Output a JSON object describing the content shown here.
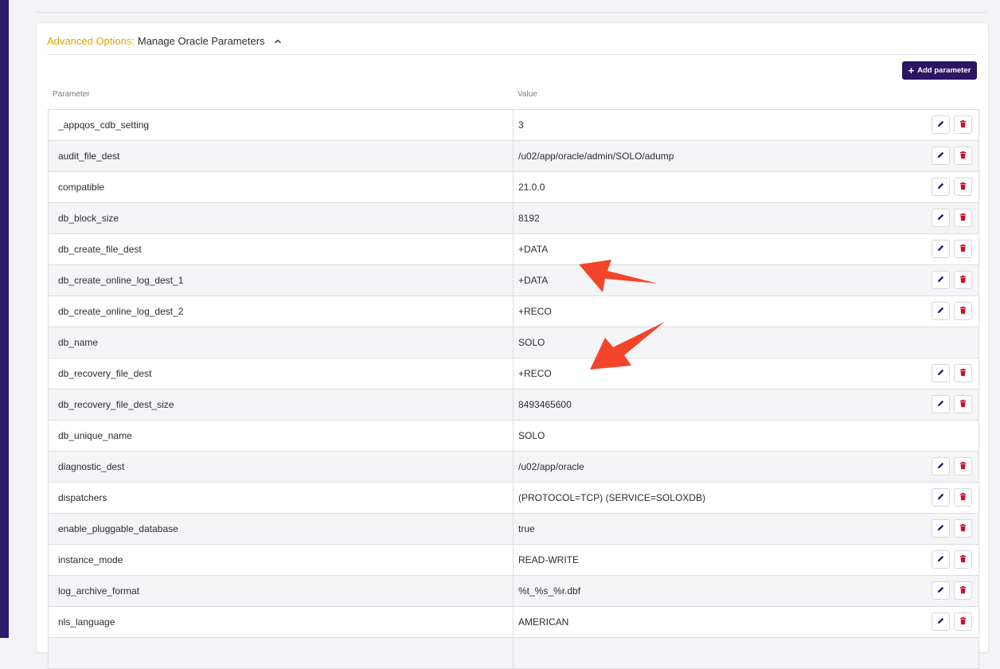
{
  "panel": {
    "title_accent": "Advanced Options:",
    "title_main": "Manage Oracle Parameters",
    "add_button_label": "Add parameter"
  },
  "table": {
    "headers": {
      "parameter": "Parameter",
      "value": "Value"
    },
    "rows": [
      {
        "name": "_appqos_cdb_setting",
        "value": "3",
        "editable": true
      },
      {
        "name": "audit_file_dest",
        "value": "/u02/app/oracle/admin/SOLO/adump",
        "editable": true
      },
      {
        "name": "compatible",
        "value": "21.0.0",
        "editable": true
      },
      {
        "name": "db_block_size",
        "value": "8192",
        "editable": true
      },
      {
        "name": "db_create_file_dest",
        "value": "+DATA",
        "editable": true
      },
      {
        "name": "db_create_online_log_dest_1",
        "value": "+DATA",
        "editable": true
      },
      {
        "name": "db_create_online_log_dest_2",
        "value": "+RECO",
        "editable": true
      },
      {
        "name": "db_name",
        "value": "SOLO",
        "editable": false
      },
      {
        "name": "db_recovery_file_dest",
        "value": "+RECO",
        "editable": true
      },
      {
        "name": "db_recovery_file_dest_size",
        "value": "8493465600",
        "editable": true
      },
      {
        "name": "db_unique_name",
        "value": "SOLO",
        "editable": false
      },
      {
        "name": "diagnostic_dest",
        "value": "/u02/app/oracle",
        "editable": true
      },
      {
        "name": "dispatchers",
        "value": "(PROTOCOL=TCP) (SERVICE=SOLOXDB)",
        "editable": true
      },
      {
        "name": "enable_pluggable_database",
        "value": "true",
        "editable": true
      },
      {
        "name": "instance_mode",
        "value": "READ-WRITE",
        "editable": true
      },
      {
        "name": "log_archive_format",
        "value": "%t_%s_%r.dbf",
        "editable": true
      },
      {
        "name": "nls_language",
        "value": "AMERICAN",
        "editable": true
      },
      {
        "name": "",
        "value": "",
        "editable": false
      }
    ]
  },
  "icons": {
    "edit": "pencil-icon",
    "delete": "trash-icon",
    "collapse": "chevron-up-icon",
    "add": "plus-icon"
  },
  "colors": {
    "accent": "#e2a400",
    "brand": "#2b1663",
    "edit_icon": "#2b1663",
    "delete_icon": "#c4122f",
    "annotation_arrow": "#f4452a",
    "left_rail": "#2d1b6e"
  }
}
